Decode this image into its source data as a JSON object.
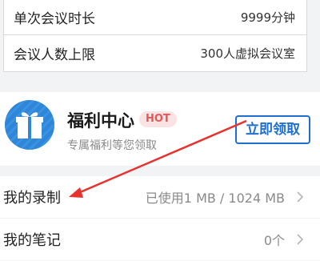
{
  "spec_table": {
    "rows": [
      {
        "label": "单次会议时长",
        "value": "9999分钟"
      },
      {
        "label": "会议人数上限",
        "value": "300人虚拟会议室"
      }
    ]
  },
  "welfare": {
    "title": "福利中心",
    "badge": "HOT",
    "subtitle": "专属福利等您领取",
    "claim_label": "立即领取",
    "icon": "gift-icon"
  },
  "list": {
    "recording": {
      "label": "我的录制",
      "value": "已使用1 MB / 1024 MB"
    },
    "notes": {
      "label": "我的笔记",
      "value": "0个"
    }
  },
  "colors": {
    "accent_blue": "#1f6fd0",
    "annotation_red": "#e8322f",
    "hot_text": "#e05a5a",
    "hot_bg": "#fbe3e3"
  }
}
